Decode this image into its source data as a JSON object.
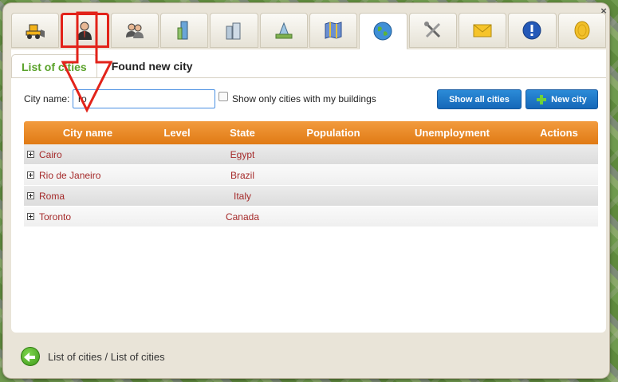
{
  "toolbar": {
    "buttons": [
      {
        "icon": "bulldozer-icon"
      },
      {
        "icon": "businessman-icon"
      },
      {
        "icon": "people-icon"
      },
      {
        "icon": "skyscraper-icon"
      },
      {
        "icon": "buildings-icon"
      },
      {
        "icon": "office-tower-icon"
      },
      {
        "icon": "map-icon"
      },
      {
        "icon": "globe-icon",
        "active": true
      },
      {
        "icon": "tools-icon"
      },
      {
        "icon": "envelope-icon"
      },
      {
        "icon": "alert-icon"
      },
      {
        "icon": "coin-icon"
      }
    ]
  },
  "tabs": {
    "list_of_cities": "List of cities",
    "found_new_city": "Found new city"
  },
  "search": {
    "label": "City name:",
    "value": "ro",
    "checkbox_label": "Show only cities with my buildings",
    "show_all_label": "Show all cities",
    "new_city_label": "New city"
  },
  "table": {
    "headers": {
      "city": "City name",
      "level": "Level",
      "state": "State",
      "population": "Population",
      "unemployment": "Unemployment",
      "actions": "Actions"
    },
    "rows": [
      {
        "city": "Cairo",
        "state": "Egypt"
      },
      {
        "city": "Rio de Janeiro",
        "state": "Brazil"
      },
      {
        "city": "Roma",
        "state": "Italy"
      },
      {
        "city": "Toronto",
        "state": "Canada"
      }
    ]
  },
  "footer": {
    "breadcrumb": "List of cities / List of cities"
  },
  "colors": {
    "accent_orange": "#e98a26",
    "tab_green": "#5aa22a",
    "link_red": "#a52a2a",
    "button_blue": "#1e78c8",
    "annotation_red": "#e2231a"
  }
}
